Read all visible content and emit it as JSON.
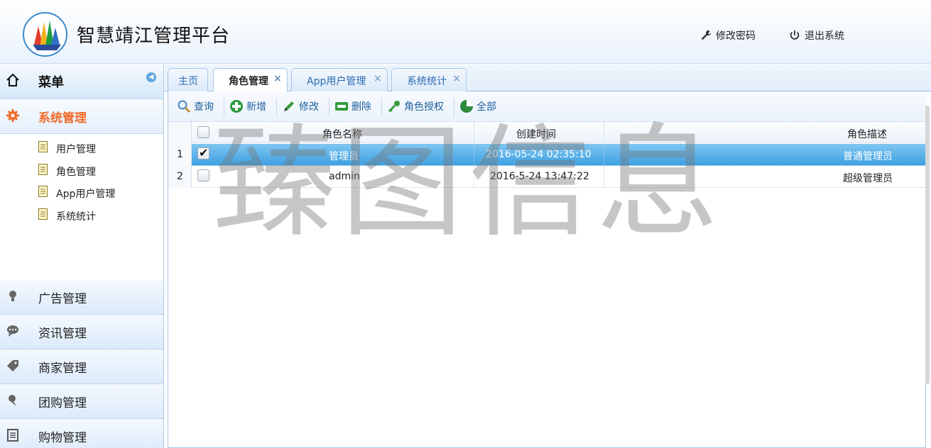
{
  "header": {
    "title": "智慧靖江管理平台",
    "change_password": "修改密码",
    "logout": "退出系统"
  },
  "sidebar": {
    "menu_label": "菜单",
    "active_section": "系统管理",
    "sub_items": [
      "用户管理",
      "角色管理",
      "App用户管理",
      "系统统计"
    ],
    "sections": [
      "广告管理",
      "资讯管理",
      "商家管理",
      "团购管理",
      "购物管理"
    ]
  },
  "tabs": [
    {
      "label": "主页",
      "closable": false
    },
    {
      "label": "角色管理",
      "closable": true,
      "active": true
    },
    {
      "label": "App用户管理",
      "closable": true
    },
    {
      "label": "系统统计",
      "closable": true
    }
  ],
  "toolbar": {
    "query": "查询",
    "add": "新增",
    "edit": "修改",
    "delete": "删除",
    "authorize": "角色授权",
    "all": "全部"
  },
  "grid": {
    "columns": [
      "角色名称",
      "创建时间",
      "角色描述"
    ],
    "rows": [
      {
        "num": "1",
        "name": "管理员",
        "created": "2016-05-24 02:35:10",
        "desc": "普通管理员",
        "checked": true,
        "selected": true
      },
      {
        "num": "2",
        "name": "admin",
        "created": "2016-5-24 13:47:22",
        "desc": "超级管理员",
        "checked": false,
        "selected": false
      }
    ]
  },
  "watermark": "臻图信息",
  "colors": {
    "accent": "#f26b2a",
    "link": "#2b6cb0",
    "selected_row": "#3ea1e3"
  }
}
